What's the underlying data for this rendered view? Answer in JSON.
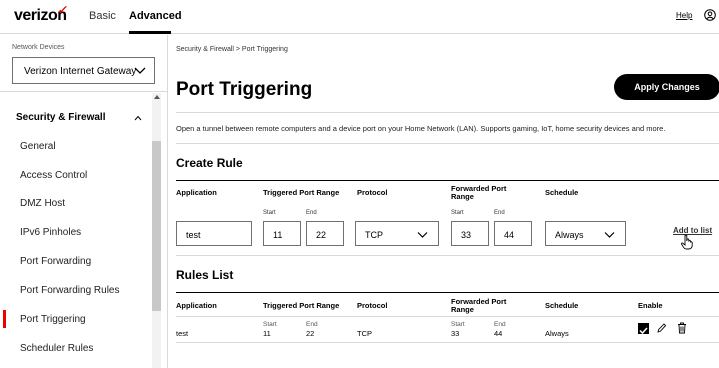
{
  "header": {
    "logo_text": "verizon",
    "logo_mark": "✓",
    "nav": {
      "basic": "Basic",
      "advanced": "Advanced"
    },
    "help": "Help",
    "user_icon": "user-circle-icon"
  },
  "sidebar": {
    "network_devices_label": "Network Devices",
    "device_select_value": "Verizon Internet Gateway",
    "section_title": "Security & Firewall",
    "items": [
      {
        "label": "General"
      },
      {
        "label": "Access Control"
      },
      {
        "label": "DMZ Host"
      },
      {
        "label": "IPv6 Pinholes"
      },
      {
        "label": "Port Forwarding"
      },
      {
        "label": "Port Forwarding Rules"
      },
      {
        "label": "Port Triggering",
        "active": true
      },
      {
        "label": "Scheduler Rules"
      }
    ]
  },
  "main": {
    "breadcrumb": "Security & Firewall  >  Port Triggering",
    "title": "Port Triggering",
    "apply_button": "Apply Changes",
    "description": "Open a tunnel between remote computers and a device port on your Home Network (LAN). Supports gaming, IoT, home security devices and more.",
    "create_rule": {
      "heading": "Create Rule",
      "columns": {
        "application": "Application",
        "triggered": "Triggered Port Range",
        "protocol": "Protocol",
        "forwarded": "Forwarded Port Range",
        "schedule": "Schedule"
      },
      "sub_start": "Start",
      "sub_end": "End",
      "values": {
        "application": "test",
        "triggered_start": "11",
        "triggered_end": "22",
        "protocol": "TCP",
        "forwarded_start": "33",
        "forwarded_end": "44",
        "schedule": "Always"
      },
      "add_link": "Add to list"
    },
    "rules_list": {
      "heading": "Rules List",
      "columns": {
        "application": "Application",
        "triggered": "Triggered Port Range",
        "protocol": "Protocol",
        "forwarded": "Forwarded Port Range",
        "schedule": "Schedule",
        "enable": "Enable"
      },
      "row": {
        "application": "test",
        "trig_start_label": "Start",
        "trig_start": "11",
        "trig_end_label": "End",
        "trig_end": "22",
        "protocol": "TCP",
        "fwd_start_label": "Start",
        "fwd_start": "33",
        "fwd_end_label": "End",
        "fwd_end": "44",
        "schedule": "Always",
        "enabled": true
      }
    }
  },
  "colors": {
    "brand_red": "#ee0000",
    "button_black": "#000000",
    "divider": "#d8dada"
  }
}
